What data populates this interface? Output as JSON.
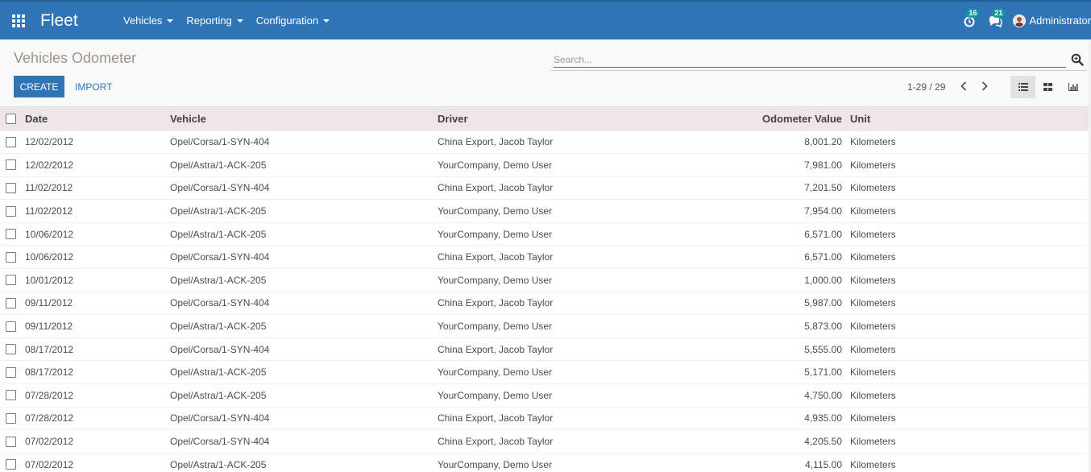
{
  "navbar": {
    "app_name": "Fleet",
    "menus": [
      "Vehicles",
      "Reporting",
      "Configuration"
    ],
    "activity_count": "16",
    "messages_count": "21",
    "user_name": "Administrator",
    "bg_color": "#2f74b5"
  },
  "control": {
    "title": "Vehicles Odometer",
    "search_placeholder": "Search...",
    "create_label": "CREATE",
    "import_label": "IMPORT",
    "pager": "1-29 / 29"
  },
  "table": {
    "headers": {
      "date": "Date",
      "vehicle": "Vehicle",
      "driver": "Driver",
      "odometer": "Odometer Value",
      "unit": "Unit"
    },
    "rows": [
      {
        "date": "12/02/2012",
        "vehicle": "Opel/Corsa/1-SYN-404",
        "driver": "China Export, Jacob Taylor",
        "odometer": "8,001.20",
        "unit": "Kilometers"
      },
      {
        "date": "12/02/2012",
        "vehicle": "Opel/Astra/1-ACK-205",
        "driver": "YourCompany, Demo User",
        "odometer": "7,981.00",
        "unit": "Kilometers"
      },
      {
        "date": "11/02/2012",
        "vehicle": "Opel/Corsa/1-SYN-404",
        "driver": "China Export, Jacob Taylor",
        "odometer": "7,201.50",
        "unit": "Kilometers"
      },
      {
        "date": "11/02/2012",
        "vehicle": "Opel/Astra/1-ACK-205",
        "driver": "YourCompany, Demo User",
        "odometer": "7,954.00",
        "unit": "Kilometers"
      },
      {
        "date": "10/06/2012",
        "vehicle": "Opel/Astra/1-ACK-205",
        "driver": "YourCompany, Demo User",
        "odometer": "6,571.00",
        "unit": "Kilometers"
      },
      {
        "date": "10/06/2012",
        "vehicle": "Opel/Corsa/1-SYN-404",
        "driver": "China Export, Jacob Taylor",
        "odometer": "6,571.00",
        "unit": "Kilometers"
      },
      {
        "date": "10/01/2012",
        "vehicle": "Opel/Astra/1-ACK-205",
        "driver": "YourCompany, Demo User",
        "odometer": "1,000.00",
        "unit": "Kilometers"
      },
      {
        "date": "09/11/2012",
        "vehicle": "Opel/Corsa/1-SYN-404",
        "driver": "China Export, Jacob Taylor",
        "odometer": "5,987.00",
        "unit": "Kilometers"
      },
      {
        "date": "09/11/2012",
        "vehicle": "Opel/Astra/1-ACK-205",
        "driver": "YourCompany, Demo User",
        "odometer": "5,873.00",
        "unit": "Kilometers"
      },
      {
        "date": "08/17/2012",
        "vehicle": "Opel/Corsa/1-SYN-404",
        "driver": "China Export, Jacob Taylor",
        "odometer": "5,555.00",
        "unit": "Kilometers"
      },
      {
        "date": "08/17/2012",
        "vehicle": "Opel/Astra/1-ACK-205",
        "driver": "YourCompany, Demo User",
        "odometer": "5,171.00",
        "unit": "Kilometers"
      },
      {
        "date": "07/28/2012",
        "vehicle": "Opel/Astra/1-ACK-205",
        "driver": "YourCompany, Demo User",
        "odometer": "4,750.00",
        "unit": "Kilometers"
      },
      {
        "date": "07/28/2012",
        "vehicle": "Opel/Corsa/1-SYN-404",
        "driver": "China Export, Jacob Taylor",
        "odometer": "4,935.00",
        "unit": "Kilometers"
      },
      {
        "date": "07/02/2012",
        "vehicle": "Opel/Corsa/1-SYN-404",
        "driver": "China Export, Jacob Taylor",
        "odometer": "4,205.50",
        "unit": "Kilometers"
      },
      {
        "date": "07/02/2012",
        "vehicle": "Opel/Astra/1-ACK-205",
        "driver": "YourCompany, Demo User",
        "odometer": "4,115.00",
        "unit": "Kilometers"
      }
    ]
  },
  "icons": [
    "apps-grid-icon",
    "activity-clock-icon",
    "messages-icon",
    "search-icon",
    "chevron-left-icon",
    "chevron-right-icon",
    "list-view-icon",
    "kanban-view-icon",
    "graph-view-icon"
  ]
}
